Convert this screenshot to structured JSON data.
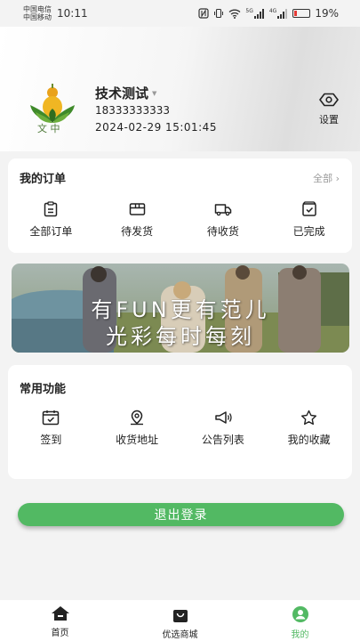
{
  "status_bar": {
    "carrier_1": "中国电信",
    "carrier_2": "中国移动",
    "time": "10:11",
    "battery": "19%",
    "battery_level": 0.19,
    "signal_1": "5G",
    "signal_2": "4G"
  },
  "profile": {
    "logo_text": "文 中",
    "name": "技术测试",
    "phone": "18333333333",
    "datetime": "2024-02-29 15:01:45",
    "settings_label": "设置"
  },
  "orders": {
    "title": "我的订单",
    "all_label": "全部",
    "items": [
      {
        "label": "全部订单",
        "icon": "clipboard-icon"
      },
      {
        "label": "待发货",
        "icon": "box-icon"
      },
      {
        "label": "待收货",
        "icon": "truck-icon"
      },
      {
        "label": "已完成",
        "icon": "check-box-icon"
      }
    ]
  },
  "banner": {
    "line_1": "有FUN更有范儿",
    "line_2": "光彩每时每刻"
  },
  "functions": {
    "title": "常用功能",
    "items": [
      {
        "label": "签到",
        "icon": "calendar-check-icon"
      },
      {
        "label": "收货地址",
        "icon": "location-icon"
      },
      {
        "label": "公告列表",
        "icon": "megaphone-icon"
      },
      {
        "label": "我的收藏",
        "icon": "star-icon"
      }
    ]
  },
  "logout_label": "退出登录",
  "tabbar": {
    "items": [
      {
        "label": "首页",
        "icon": "home-icon"
      },
      {
        "label": "优选商城",
        "icon": "shopping-bag-icon"
      },
      {
        "label": "我的",
        "icon": "user-icon"
      }
    ],
    "active": "我的",
    "accent_color": "#52b963"
  }
}
